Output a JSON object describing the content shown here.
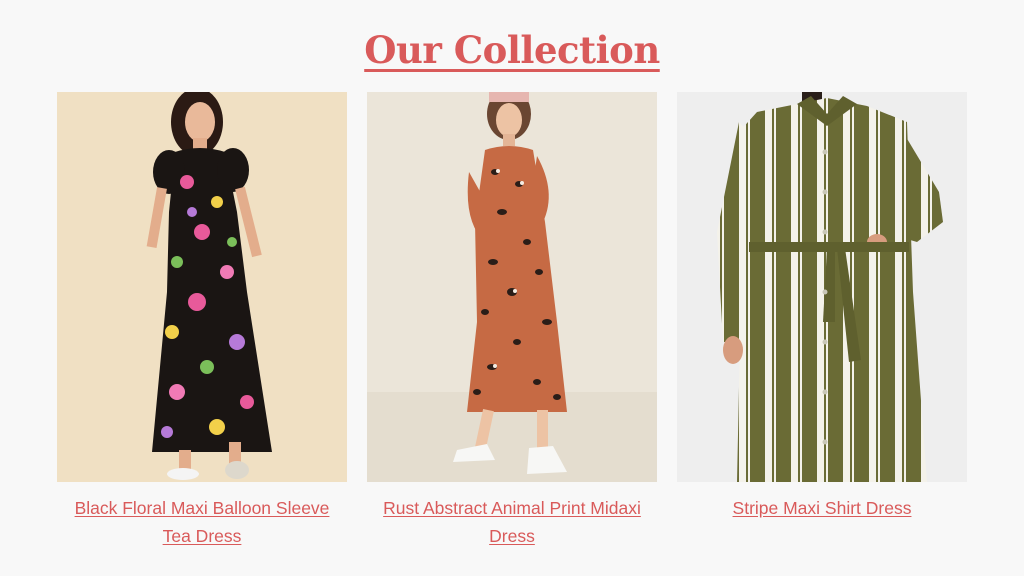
{
  "page": {
    "title": "Our Collection"
  },
  "colors": {
    "accent": "#d95a5a",
    "background": "#f8f8f8"
  },
  "products": [
    {
      "name": "Black Floral Maxi Balloon Sleeve Tea Dress",
      "image_desc": "floral-dress-photo"
    },
    {
      "name": "Rust Abstract Animal Print Midaxi Dress",
      "image_desc": "animal-print-dress-photo"
    },
    {
      "name": "Stripe Maxi Shirt Dress",
      "image_desc": "stripe-dress-photo"
    }
  ]
}
